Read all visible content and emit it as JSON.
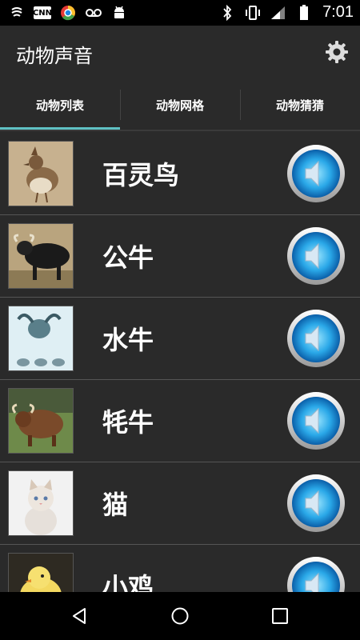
{
  "status_bar": {
    "time": "7:01",
    "left_icons": [
      "signal-app-icon",
      "cnn-icon",
      "chrome-icon",
      "voicemail-icon",
      "android-icon"
    ],
    "cnn_label": "CNN",
    "right_icons": [
      "bluetooth-icon",
      "vibrate-icon",
      "cell-signal-icon",
      "battery-icon"
    ]
  },
  "app_bar": {
    "title": "动物声音",
    "settings_icon": "gear-icon"
  },
  "tabs": [
    {
      "label": "动物列表",
      "active": true
    },
    {
      "label": "动物网格",
      "active": false
    },
    {
      "label": "动物猜猜",
      "active": false
    }
  ],
  "animals": [
    {
      "name": "百灵鸟",
      "image": "lark-bird-photo"
    },
    {
      "name": "公牛",
      "image": "bull-photo"
    },
    {
      "name": "水牛",
      "image": "water-buffalo-photo"
    },
    {
      "name": "牦牛",
      "image": "yak-photo"
    },
    {
      "name": "猫",
      "image": "kitten-photo"
    },
    {
      "name": "小鸡",
      "image": "chick-photo"
    }
  ],
  "nav_bar": {
    "back": "back-icon",
    "home": "home-icon",
    "recents": "recents-icon"
  },
  "colors": {
    "background": "#2a2a2a",
    "tab_indicator": "#5fc0c3",
    "speaker_blue": "#1e90d8"
  }
}
